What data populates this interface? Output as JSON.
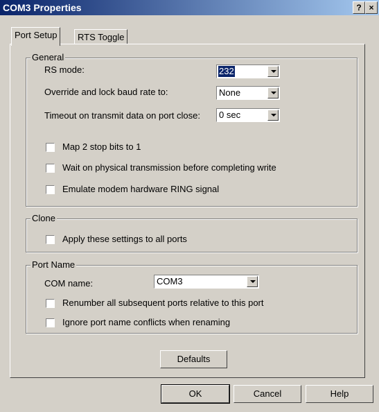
{
  "window": {
    "title": "COM3 Properties",
    "help_glyph": "?",
    "close_glyph": "×"
  },
  "tabs": [
    {
      "label": "Port Setup",
      "active": true
    },
    {
      "label": "RTS Toggle",
      "active": false
    }
  ],
  "general": {
    "legend": "General",
    "rs_mode": {
      "label": "RS mode:",
      "value": "232"
    },
    "baud": {
      "label": "Override and lock baud rate to:",
      "value": "None"
    },
    "timeout": {
      "label": "Timeout on transmit data on port close:",
      "value": "0 sec"
    },
    "checkboxes": [
      {
        "label": "Map 2 stop bits to 1",
        "checked": false
      },
      {
        "label": "Wait on physical transmission before completing write",
        "checked": false
      },
      {
        "label": "Emulate modem hardware RING signal",
        "checked": false
      }
    ]
  },
  "clone": {
    "legend": "Clone",
    "checkbox": {
      "label": "Apply these settings to all ports",
      "checked": false
    }
  },
  "port_name": {
    "legend": "Port Name",
    "com_name": {
      "label": "COM name:",
      "value": "COM3"
    },
    "checkboxes": [
      {
        "label": "Renumber all subsequent ports relative to this port",
        "checked": false
      },
      {
        "label": "Ignore port name conflicts when renaming",
        "checked": false
      }
    ]
  },
  "buttons": {
    "defaults": "Defaults",
    "ok": "OK",
    "cancel": "Cancel",
    "help": "Help"
  }
}
